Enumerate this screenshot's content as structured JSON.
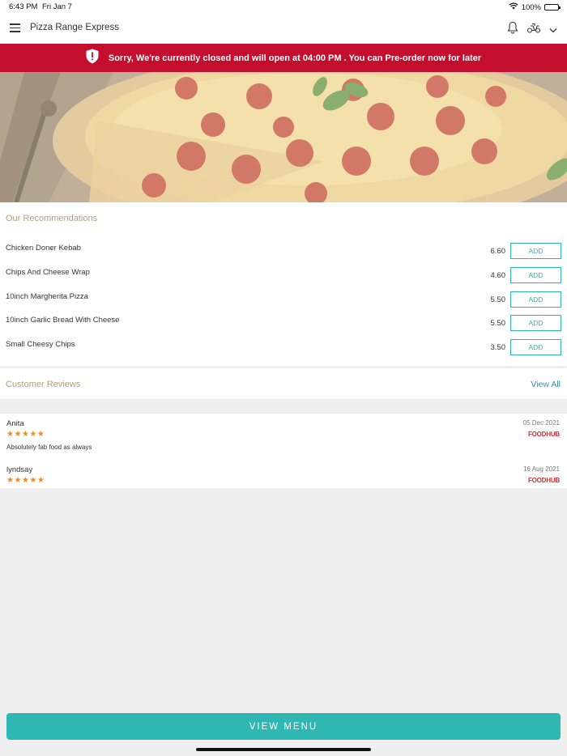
{
  "status_bar": {
    "time": "6:43 PM",
    "date": "Fri Jan 7",
    "battery": "100%"
  },
  "header": {
    "title": "Pizza Range Express"
  },
  "banner": {
    "message": "Sorry, We're currently closed and will open at 04:00 PM . You can Pre-order now for later",
    "color": "#c30e2e"
  },
  "recommendations": {
    "title": "Our Recommendations",
    "add_label": "ADD",
    "items": [
      {
        "name": "Chicken Doner Kebab",
        "price": "6.60"
      },
      {
        "name": "Chips And Cheese Wrap",
        "price": "4.60"
      },
      {
        "name": "10inch Margherita Pizza",
        "price": "5.50"
      },
      {
        "name": "10inch Garlic Bread With Cheese",
        "price": "5.50"
      },
      {
        "name": "Small Cheesy Chips",
        "price": "3.50"
      }
    ]
  },
  "reviews": {
    "title": "Customer Reviews",
    "view_all": "View All",
    "items": [
      {
        "author": "Anita",
        "rating": 5,
        "date": "05 Dec 2021",
        "source": "FOODHUB",
        "comment": "Absolutely fab food as always"
      },
      {
        "author": "lyndsay",
        "rating": 5,
        "date": "16 Aug 2021",
        "source": "FOODHUB",
        "comment": ""
      }
    ]
  },
  "footer": {
    "view_menu": "VIEW MENU",
    "accent": "#2eb7b3"
  }
}
